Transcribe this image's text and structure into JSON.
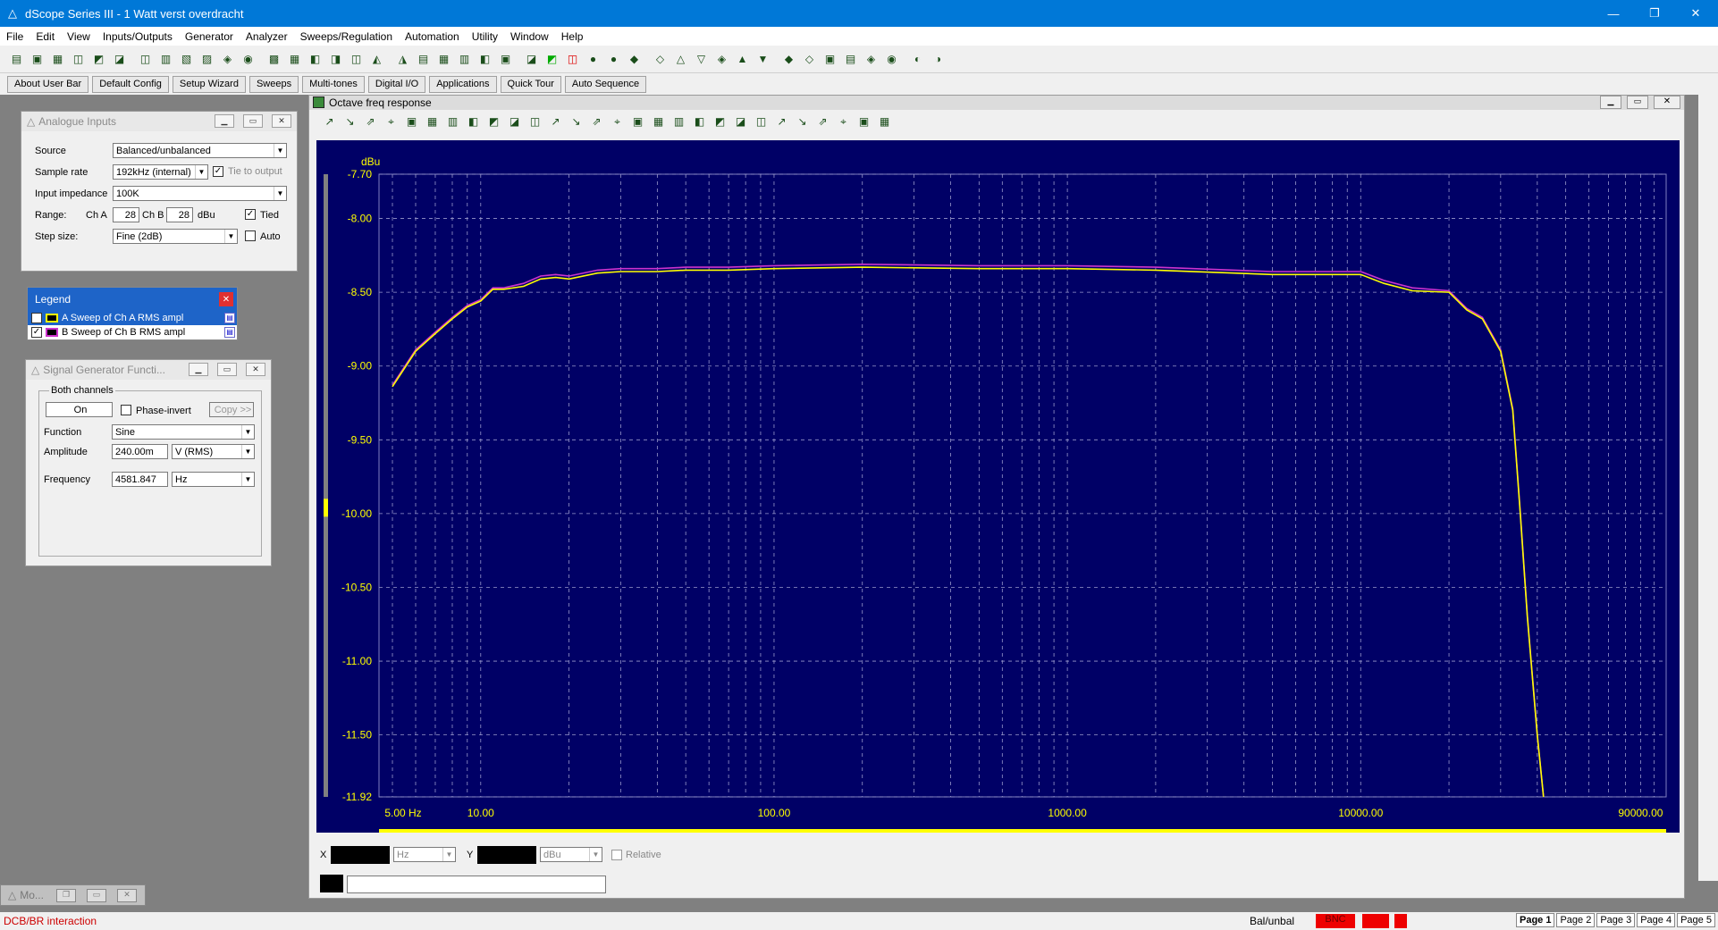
{
  "window": {
    "title": "dScope Series III - 1 Watt verst overdracht"
  },
  "menu": [
    "File",
    "Edit",
    "View",
    "Inputs/Outputs",
    "Generator",
    "Analyzer",
    "Sweeps/Regulation",
    "Automation",
    "Utility",
    "Window",
    "Help"
  ],
  "userbar": [
    "About User Bar",
    "Default Config",
    "Setup Wizard",
    "Sweeps",
    "Multi-tones",
    "Digital I/O",
    "Applications",
    "Quick Tour",
    "Auto Sequence"
  ],
  "analogue": {
    "title": "Analogue Inputs",
    "source_label": "Source",
    "source": "Balanced/unbalanced",
    "rate_label": "Sample rate",
    "rate": "192kHz (internal)",
    "tie": "Tie to output",
    "imp_label": "Input impedance",
    "imp": "100K",
    "range_label": "Range:",
    "cha": "Ch A",
    "cha_val": "28",
    "chb": "Ch B",
    "chb_val": "28",
    "unit": "dBu",
    "tied": "Tied",
    "step_label": "Step size:",
    "step": "Fine (2dB)",
    "auto": "Auto"
  },
  "legend": {
    "title": "Legend",
    "a": "A  Sweep of Ch A RMS ampl",
    "b": "B  Sweep of Ch B RMS ampl",
    "a_color": "#ffff00",
    "b_color": "#cc33cc"
  },
  "gen": {
    "title": "Signal Generator Functi...",
    "group": "Both channels",
    "on": "On",
    "phase": "Phase-invert",
    "copy": "Copy >>",
    "func_label": "Function",
    "func": "Sine",
    "amp_label": "Amplitude",
    "amp": "240.00m",
    "amp_unit": "V (RMS)",
    "freq_label": "Frequency",
    "freq": "4581.847",
    "freq_unit": "Hz"
  },
  "graph": {
    "title": "Octave freq response"
  },
  "chart_data": {
    "type": "line",
    "title": "",
    "ylabel": "dBu",
    "xlabel": "",
    "xscale": "log",
    "xlim": [
      4.5,
      110000
    ],
    "ylim": [
      -11.92,
      -7.7
    ],
    "yticks": [
      "-7.70",
      "-8.00",
      "-8.50",
      "-9.00",
      "-9.50",
      "-10.00",
      "-10.50",
      "-11.00",
      "-11.50",
      "-11.92"
    ],
    "yvals": [
      -7.7,
      -8.0,
      -8.5,
      -9.0,
      -9.5,
      -10.0,
      -10.5,
      -11.0,
      -11.5,
      -11.92
    ],
    "xticks": [
      "5.00 Hz",
      "10.00",
      "100.00",
      "1000.00",
      "10000.00",
      "90000.00"
    ],
    "xvals": [
      5,
      10,
      100,
      1000,
      10000,
      90000
    ],
    "grid": true,
    "series": [
      {
        "name": "A Sweep of Ch A RMS ampl",
        "color": "#ffff00",
        "x": [
          5,
          6,
          7,
          8,
          9,
          10,
          11,
          12,
          14,
          16,
          18,
          20,
          25,
          30,
          40,
          50,
          70,
          100,
          200,
          500,
          1000,
          2000,
          5000,
          10000,
          12000,
          15000,
          20000,
          23000,
          26000,
          30000,
          33000,
          35000,
          37000,
          40000,
          42000
        ],
        "y": [
          -9.14,
          -8.9,
          -8.78,
          -8.68,
          -8.6,
          -8.56,
          -8.48,
          -8.48,
          -8.46,
          -8.41,
          -8.4,
          -8.41,
          -8.37,
          -8.36,
          -8.36,
          -8.35,
          -8.35,
          -8.34,
          -8.33,
          -8.34,
          -8.34,
          -8.35,
          -8.38,
          -8.38,
          -8.44,
          -8.49,
          -8.5,
          -8.62,
          -8.68,
          -8.9,
          -9.3,
          -10.0,
          -10.7,
          -11.5,
          -11.92
        ]
      },
      {
        "name": "B Sweep of Ch B RMS ampl",
        "color": "#cc33cc",
        "x": [
          5,
          6,
          7,
          8,
          9,
          10,
          11,
          12,
          14,
          16,
          18,
          20,
          25,
          30,
          40,
          50,
          70,
          100,
          200,
          500,
          1000,
          2000,
          5000,
          10000,
          12000,
          15000,
          20000,
          23000,
          26000,
          30000,
          33000,
          35000,
          37000,
          40000,
          42000
        ],
        "y": [
          -9.13,
          -8.89,
          -8.77,
          -8.67,
          -8.59,
          -8.55,
          -8.47,
          -8.47,
          -8.44,
          -8.39,
          -8.38,
          -8.39,
          -8.35,
          -8.34,
          -8.34,
          -8.33,
          -8.33,
          -8.32,
          -8.31,
          -8.32,
          -8.32,
          -8.33,
          -8.36,
          -8.36,
          -8.42,
          -8.47,
          -8.49,
          -8.61,
          -8.67,
          -8.89,
          -9.29,
          -9.99,
          -10.69,
          -11.5,
          -11.92
        ]
      }
    ]
  },
  "cursor": {
    "x": "X",
    "xunit": "Hz",
    "y": "Y",
    "yunit": "dBu",
    "relative": "Relative"
  },
  "mini": {
    "label": "Mo..."
  },
  "status": {
    "left": "DCB/BR interaction",
    "right": "Bal/unbal",
    "bnc": "BNC",
    "pages": [
      "Page 1",
      "Page 2",
      "Page 3",
      "Page 4",
      "Page 5"
    ]
  }
}
